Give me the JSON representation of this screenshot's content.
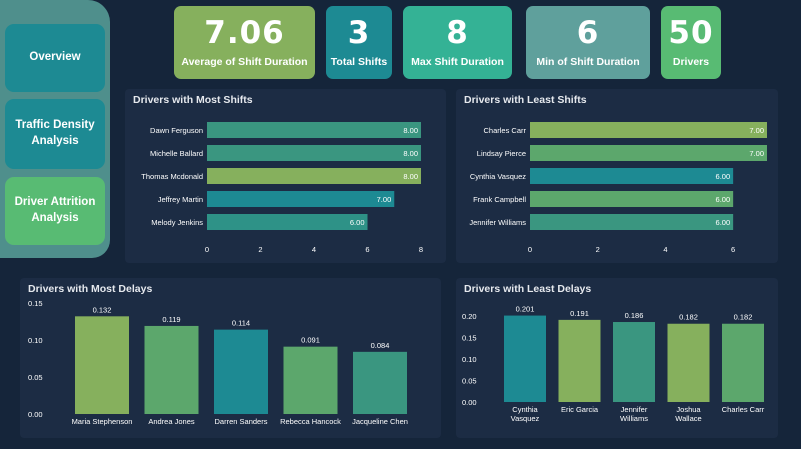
{
  "nav": {
    "overview": "Overview",
    "traffic_density": "Traffic Density Analysis",
    "driver_attrition": "Driver Attrition Analysis"
  },
  "kpis": {
    "avg_shift_duration": {
      "value": "7.06",
      "label": "Average of Shift Duration"
    },
    "total_shifts": {
      "value": "3",
      "label": "Total Shifts"
    },
    "max_shift_duration": {
      "value": "8",
      "label": "Max Shift Duration"
    },
    "min_shift_duration": {
      "value": "6",
      "label": "Min of Shift Duration"
    },
    "drivers": {
      "value": "50",
      "label": "Drivers"
    }
  },
  "colors": {
    "teal": "#1d8a93",
    "sea_green": "#3a9680",
    "lime": "#86b05d",
    "green": "#5ca76c",
    "jade": "#34b295"
  },
  "chart_data": [
    {
      "id": "most_shifts",
      "type": "bar",
      "orientation": "horizontal",
      "title": "Drivers with Most Shifts",
      "categories": [
        "Dawn Ferguson",
        "Michelle Ballard",
        "Thomas Mcdonald",
        "Jeffrey Martin",
        "Melody Jenkins"
      ],
      "values": [
        8,
        8,
        8,
        7,
        6
      ],
      "labels": [
        "8.00",
        "8.00",
        "8.00",
        "7.00",
        "6.00"
      ],
      "bar_colors": [
        "#3a9680",
        "#3a9680",
        "#86b05d",
        "#1d8a93",
        "#2e9287"
      ],
      "xlim": [
        0,
        8
      ],
      "xticks": [
        "0",
        "2",
        "4",
        "6",
        "8"
      ]
    },
    {
      "id": "least_shifts",
      "type": "bar",
      "orientation": "horizontal",
      "title": "Drivers with Least Shifts",
      "categories": [
        "Charles Carr",
        "Lindsay Pierce",
        "Cynthia Vasquez",
        "Frank Campbell",
        "Jennifer Williams"
      ],
      "values": [
        7,
        7,
        6,
        6,
        6
      ],
      "labels": [
        "7.00",
        "7.00",
        "6.00",
        "6.00",
        "6.00"
      ],
      "bar_colors": [
        "#86b05d",
        "#5ca76c",
        "#1d8a93",
        "#5ca76c",
        "#3a9680"
      ],
      "xlim": [
        0,
        7
      ],
      "xticks": [
        "0",
        "2",
        "4",
        "6"
      ]
    },
    {
      "id": "most_delays",
      "type": "bar",
      "orientation": "vertical",
      "title": "Drivers with Most Delays",
      "categories": [
        "Maria Stephenson",
        "Andrea Jones",
        "Darren Sanders",
        "Rebecca Hancock",
        "Jacqueline Chen"
      ],
      "values": [
        0.132,
        0.119,
        0.114,
        0.091,
        0.084
      ],
      "labels": [
        "0.132",
        "0.119",
        "0.114",
        "0.091",
        "0.084"
      ],
      "bar_colors": [
        "#86b05d",
        "#5ca76c",
        "#1d8a93",
        "#5ca76c",
        "#3a9680"
      ],
      "ylim": [
        0,
        0.15
      ],
      "yticks": [
        "0.00",
        "0.05",
        "0.10",
        "0.15"
      ]
    },
    {
      "id": "least_delays",
      "type": "bar",
      "orientation": "vertical",
      "title": "Drivers with Least Delays",
      "categories": [
        "Cynthia Vasquez",
        "Eric Garcia",
        "Jennifer Williams",
        "Joshua Wallace",
        "Charles Carr"
      ],
      "category_lines": [
        [
          "Cynthia",
          "Vasquez"
        ],
        [
          "Eric Garcia"
        ],
        [
          "Jennifer",
          "Williams"
        ],
        [
          "Joshua",
          "Wallace"
        ],
        [
          "Charles Carr"
        ]
      ],
      "values": [
        0.201,
        0.191,
        0.186,
        0.182,
        0.182
      ],
      "labels": [
        "0.201",
        "0.191",
        "0.186",
        "0.182",
        "0.182"
      ],
      "bar_colors": [
        "#1d8a93",
        "#86b05d",
        "#3a9680",
        "#86b05d",
        "#5ca76c"
      ],
      "ylim": [
        0,
        0.2
      ],
      "yticks": [
        "0.00",
        "0.05",
        "0.10",
        "0.15",
        "0.20"
      ]
    }
  ]
}
